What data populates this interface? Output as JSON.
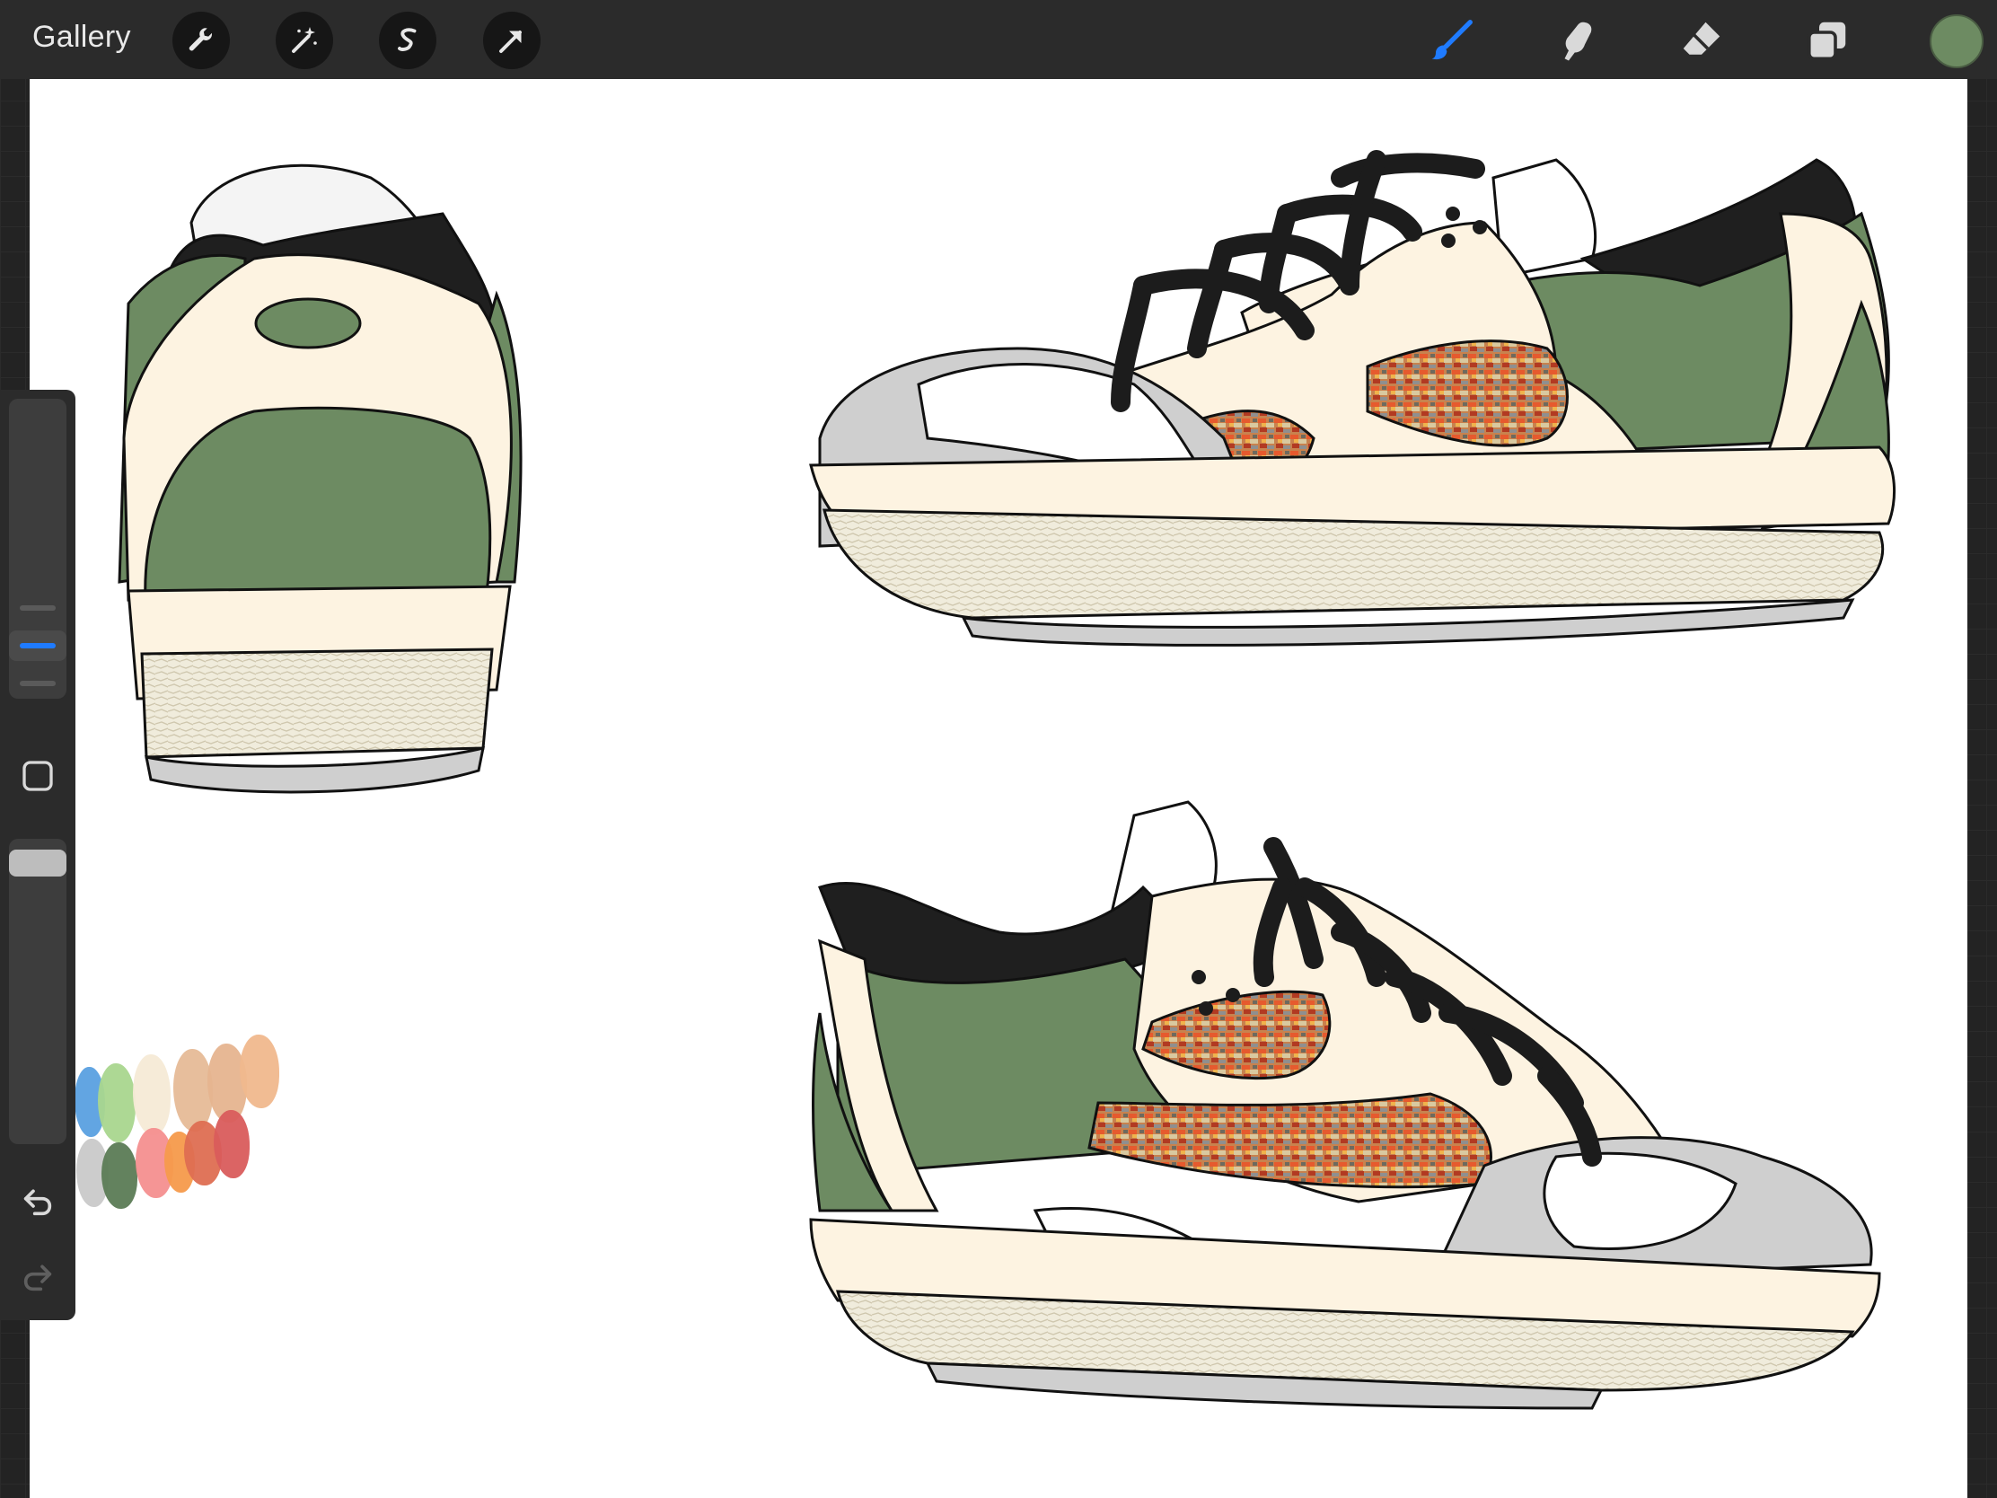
{
  "app": {
    "gallery_label": "Gallery"
  },
  "toolbar": {
    "left_tools": [
      {
        "name": "actions",
        "icon": "wrench-icon"
      },
      {
        "name": "adjustments",
        "icon": "magic-wand-icon"
      },
      {
        "name": "selection",
        "icon": "selection-s-icon"
      },
      {
        "name": "transform",
        "icon": "arrow-cursor-icon"
      }
    ],
    "right_tools": [
      {
        "name": "brush",
        "icon": "brush-icon",
        "active": true
      },
      {
        "name": "smudge",
        "icon": "smudge-finger-icon",
        "active": false
      },
      {
        "name": "eraser",
        "icon": "eraser-icon",
        "active": false
      },
      {
        "name": "layers",
        "icon": "layers-icon",
        "active": false
      }
    ],
    "current_color": "#6d8b62"
  },
  "colors": {
    "accent": "#1f7bff",
    "toolbar_bg": "#2b2b2b",
    "shoe_green": "#6d8b62",
    "shoe_cream": "#fdf3e1",
    "shoe_gray": "#cfcfcf",
    "lace_black": "#1c1c1c"
  },
  "sidebar": {
    "brush_size_level": 0.45,
    "opacity_level": 1.0,
    "buttons": [
      "modify-square-icon",
      "undo-icon",
      "redo-icon"
    ]
  },
  "palette_dabs": [
    "#5aa0e0",
    "#a9d68e",
    "#f6ead6",
    "#e6bb97",
    "#e6b48f",
    "#f0b88d",
    "#c9c9c9",
    "#5b7b55",
    "#f48f8f",
    "#f59a4b",
    "#de6e52",
    "#d95c5c"
  ]
}
